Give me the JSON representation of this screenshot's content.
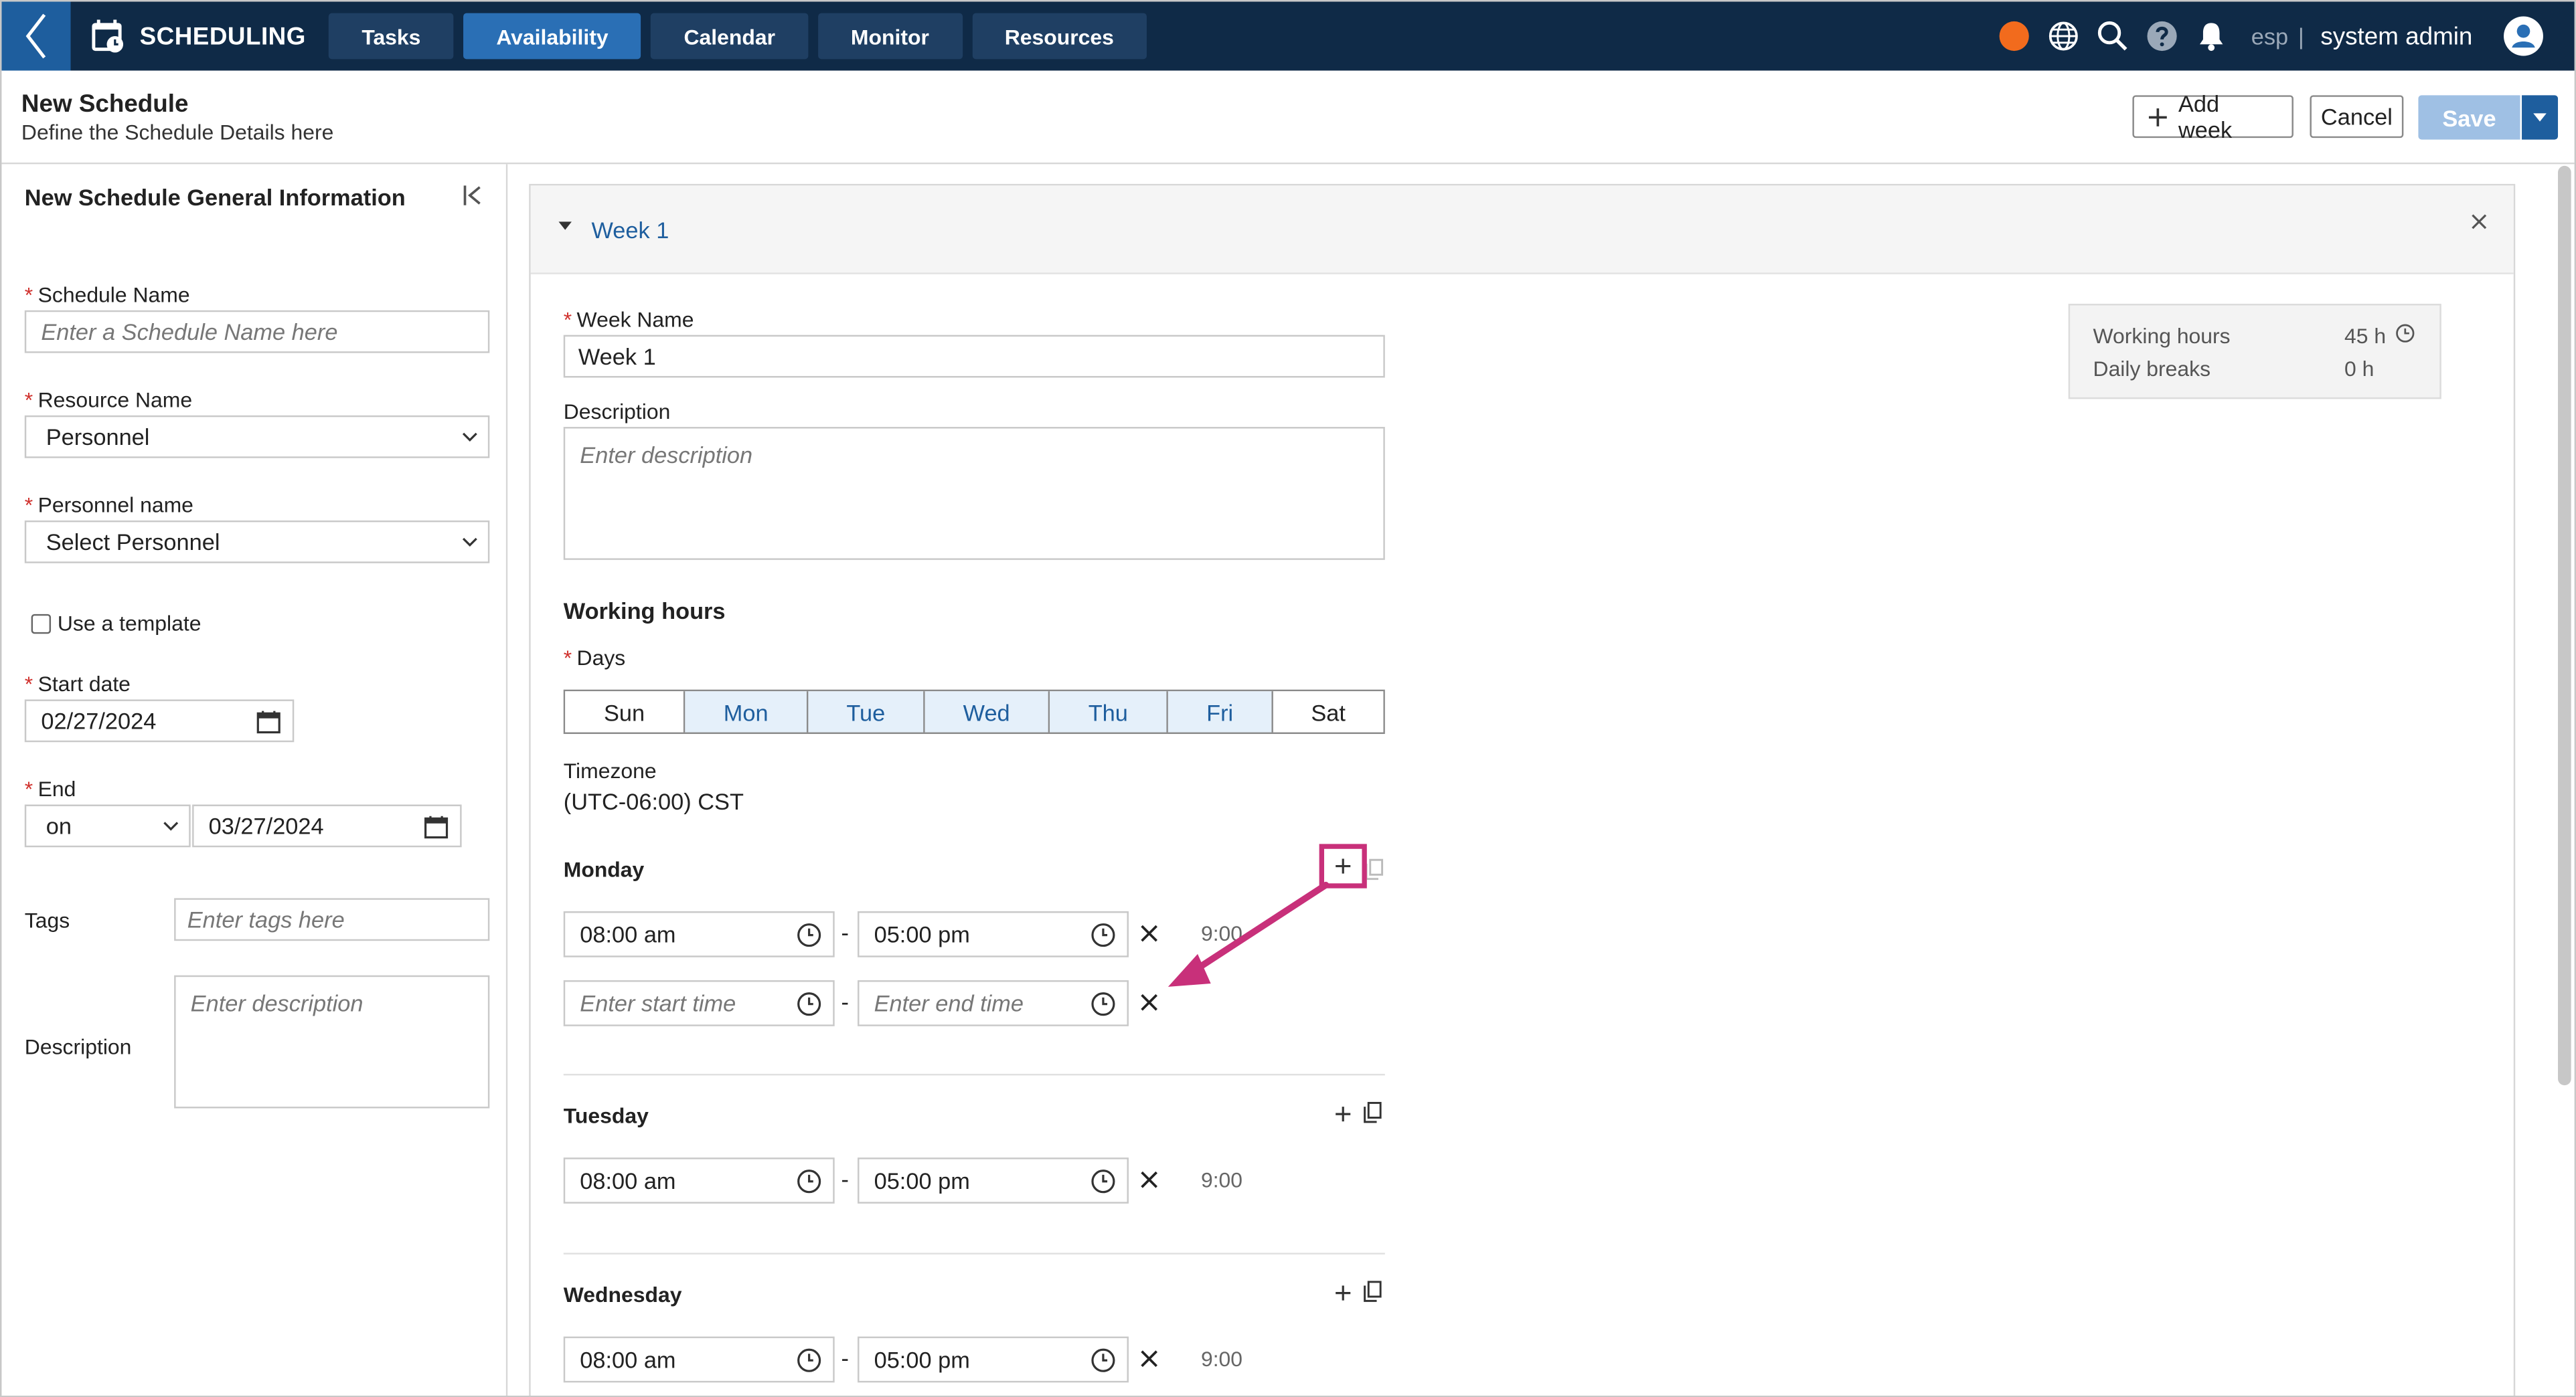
{
  "topbar": {
    "app_title": "SCHEDULING",
    "tabs": [
      {
        "label": "Tasks"
      },
      {
        "label": "Availability"
      },
      {
        "label": "Calendar"
      },
      {
        "label": "Monitor"
      },
      {
        "label": "Resources"
      }
    ],
    "language": "esp",
    "separator": "|",
    "user_name": "system admin",
    "status_color": "#f26b1d"
  },
  "header": {
    "title": "New Schedule",
    "subtitle": "Define the Schedule Details here",
    "add_week_label": "Add week",
    "cancel_label": "Cancel",
    "save_label": "Save"
  },
  "left_panel": {
    "title": "New Schedule General Information",
    "schedule_name": {
      "label": "Schedule Name",
      "placeholder": "Enter a Schedule Name here"
    },
    "resource_name": {
      "label": "Resource Name",
      "value": "Personnel"
    },
    "personnel_name": {
      "label": "Personnel name",
      "value": "Select Personnel"
    },
    "use_template_label": "Use a template",
    "start_date": {
      "label": "Start date",
      "value": "02/27/2024"
    },
    "end": {
      "label": "End",
      "mode": "on",
      "date": "03/27/2024"
    },
    "tags": {
      "label": "Tags",
      "placeholder": "Enter tags here"
    },
    "description": {
      "label": "Description",
      "placeholder": "Enter description"
    }
  },
  "week": {
    "title": "Week 1",
    "name_label": "Week Name",
    "name_value": "Week 1",
    "description_label": "Description",
    "description_placeholder": "Enter description",
    "working_hours_title": "Working hours",
    "days_label": "Days",
    "days": [
      {
        "label": "Sun",
        "selected": false
      },
      {
        "label": "Mon",
        "selected": true
      },
      {
        "label": "Tue",
        "selected": true
      },
      {
        "label": "Wed",
        "selected": true
      },
      {
        "label": "Thu",
        "selected": true
      },
      {
        "label": "Fri",
        "selected": true
      },
      {
        "label": "Sat",
        "selected": false
      }
    ],
    "timezone_label": "Timezone",
    "timezone_value": "(UTC-06:00) CST",
    "summary": {
      "working_hours_label": "Working hours",
      "working_hours_value": "45 h",
      "daily_breaks_label": "Daily breaks",
      "daily_breaks_value": "0 h"
    },
    "monday": {
      "label": "Monday",
      "slot1_start": "08:00 am",
      "slot1_end": "05:00 pm",
      "slot1_duration": "9:00",
      "slot2_start_placeholder": "Enter start time",
      "slot2_end_placeholder": "Enter end time"
    },
    "tuesday": {
      "label": "Tuesday",
      "start": "08:00 am",
      "end": "05:00 pm",
      "duration": "9:00"
    },
    "wednesday": {
      "label": "Wednesday",
      "start": "08:00 am",
      "end": "05:00 pm",
      "duration": "9:00"
    },
    "dash": "-"
  },
  "colors": {
    "annotation": "#c8307a",
    "accent": "#1e5e9e",
    "topbar": "#0f2a47"
  }
}
